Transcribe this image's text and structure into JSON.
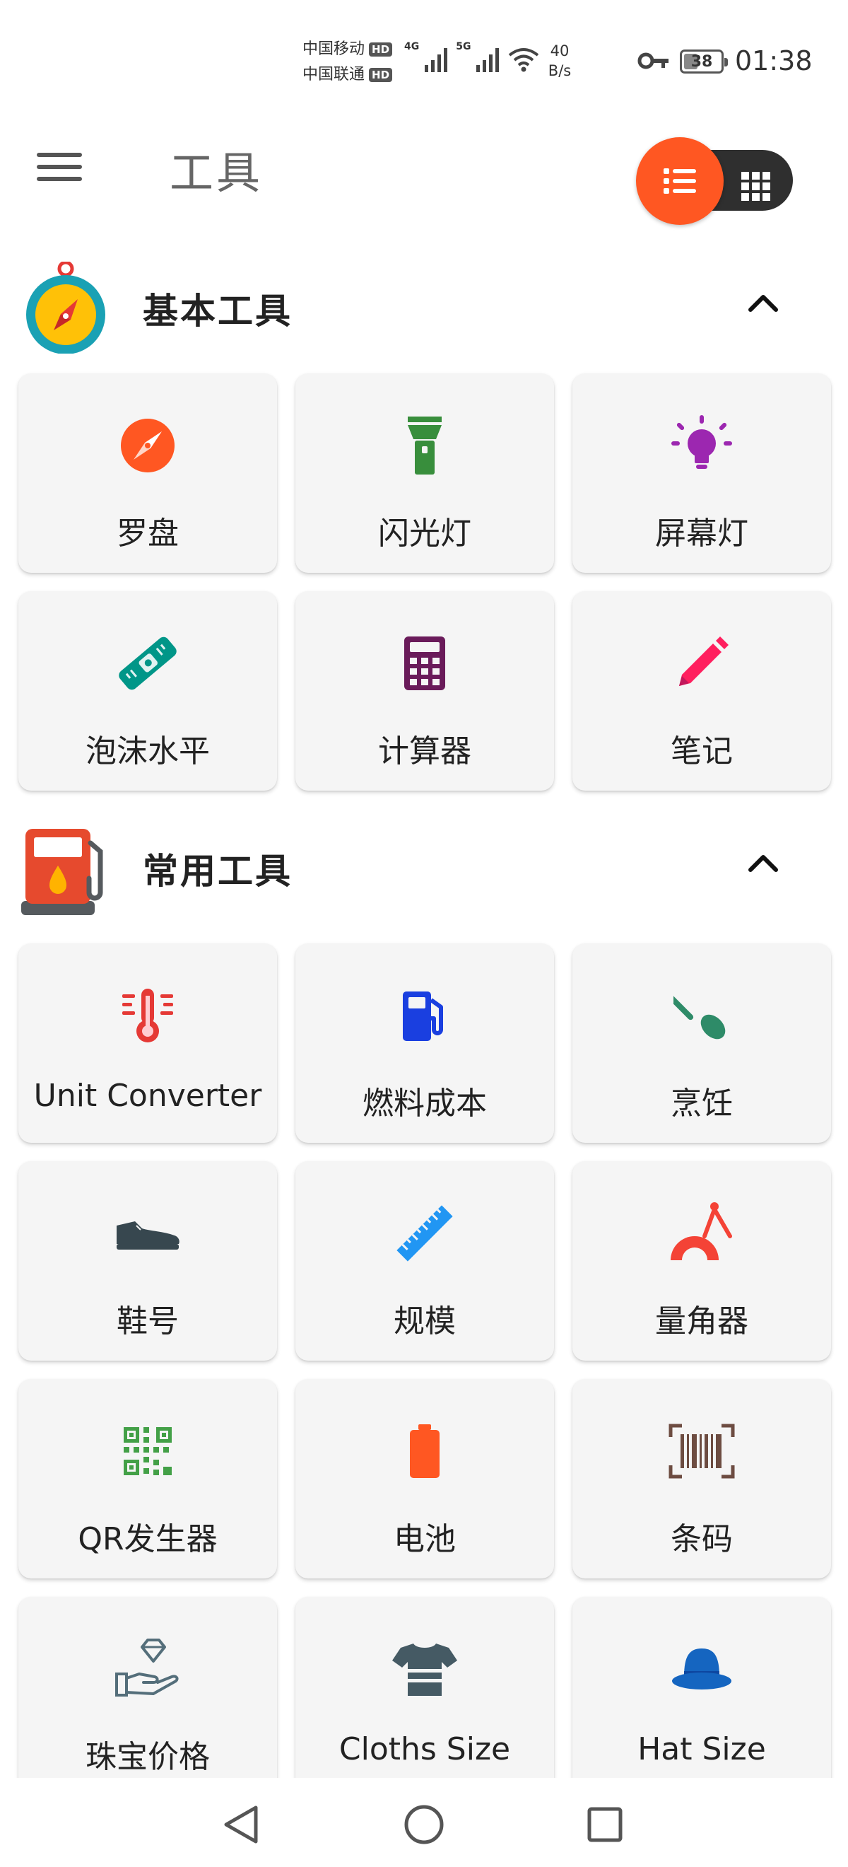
{
  "status_bar": {
    "carrier_1": "中国移动",
    "carrier_2": "中国联通",
    "hd_badge": "HD",
    "network_1": "4G",
    "network_2": "5G",
    "speed_value": "40",
    "speed_unit": "B/s",
    "battery_level": "38",
    "time": "01:38"
  },
  "app_bar": {
    "title": "工具",
    "menu_icon": "hamburger-menu-icon",
    "toggle_selected": "list",
    "accent_color": "#ff5722"
  },
  "sections": [
    {
      "title": "基本工具",
      "icon": "compass-badge-icon",
      "expanded": true,
      "tools": [
        {
          "label": "罗盘",
          "icon": "compass-icon",
          "color": "#ff5722"
        },
        {
          "label": "闪光灯",
          "icon": "flashlight-icon",
          "color": "#388e3c"
        },
        {
          "label": "屏幕灯",
          "icon": "lightbulb-icon",
          "color": "#9c27b0"
        },
        {
          "label": "泡沫水平",
          "icon": "bubble-level-icon",
          "color": "#009688"
        },
        {
          "label": "计算器",
          "icon": "calculator-icon",
          "color": "#6a1b5a"
        },
        {
          "label": "笔记",
          "icon": "pencil-icon",
          "color": "#ff1f5e"
        }
      ]
    },
    {
      "title": "常用工具",
      "icon": "fuel-pump-badge-icon",
      "expanded": true,
      "tools": [
        {
          "label": "Unit Converter",
          "icon": "thermometer-icon",
          "color": "#e53935"
        },
        {
          "label": "燃料成本",
          "icon": "fuel-pump-icon",
          "color": "#1a3fe0"
        },
        {
          "label": "烹饪",
          "icon": "spatula-icon",
          "color": "#2e8b68"
        },
        {
          "label": "鞋号",
          "icon": "shoe-icon",
          "color": "#37474f"
        },
        {
          "label": "规模",
          "icon": "ruler-icon",
          "color": "#2196f3"
        },
        {
          "label": "量角器",
          "icon": "protractor-icon",
          "color": "#f44336"
        },
        {
          "label": "QR发生器",
          "icon": "qr-code-icon",
          "color": "#43a047"
        },
        {
          "label": "电池",
          "icon": "battery-icon",
          "color": "#ff5722"
        },
        {
          "label": "条码",
          "icon": "barcode-icon",
          "color": "#6d4c41"
        },
        {
          "label": "珠宝价格",
          "icon": "diamond-hand-icon",
          "color": "#546e7a"
        },
        {
          "label": "Cloths Size",
          "icon": "tshirt-icon",
          "color": "#455a64"
        },
        {
          "label": "Hat Size",
          "icon": "hat-icon",
          "color": "#1565c0"
        }
      ]
    }
  ],
  "nav_bar": {
    "back_icon": "back-triangle-icon",
    "home_icon": "home-circle-icon",
    "recents_icon": "recents-square-icon"
  }
}
